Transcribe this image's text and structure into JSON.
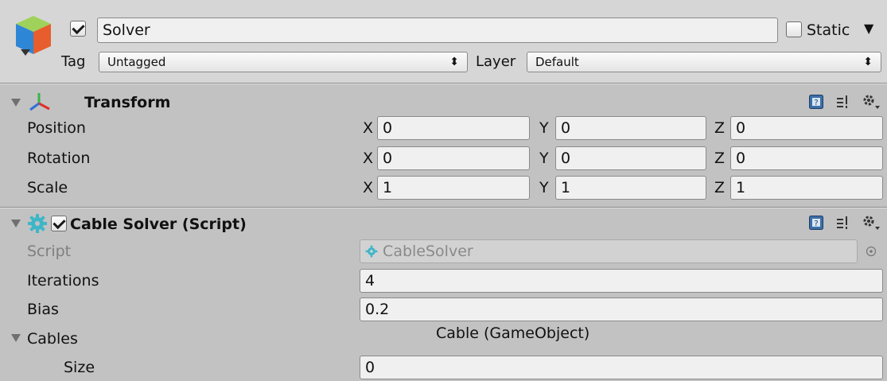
{
  "header": {
    "active_checked": true,
    "name": "Solver",
    "static_label": "Static",
    "static_checked": false,
    "tag_label": "Tag",
    "tag_value": "Untagged",
    "layer_label": "Layer",
    "layer_value": "Default",
    "popup_arrows": "⬍",
    "static_arrow": "▼"
  },
  "transform": {
    "title": "Transform",
    "rows": [
      {
        "label": "Position",
        "x": "0",
        "y": "0",
        "z": "0"
      },
      {
        "label": "Rotation",
        "x": "0",
        "y": "0",
        "z": "0"
      },
      {
        "label": "Scale",
        "x": "1",
        "y": "1",
        "z": "1"
      }
    ],
    "axes": {
      "x": "X",
      "y": "Y",
      "z": "Z"
    }
  },
  "cable_solver": {
    "title": "Cable Solver (Script)",
    "enabled": true,
    "script_label": "Script",
    "script_value": "CableSolver",
    "iterations_label": "Iterations",
    "iterations_value": "4",
    "bias_label": "Bias",
    "bias_value": "0.2",
    "cables_label": "Cables",
    "cables_type": "Cable (GameObject)",
    "size_label": "Size",
    "size_value": "0"
  },
  "colors": {
    "script_gear": "#3fb6c7",
    "help_icon": "#3c6fa8"
  },
  "icons": [
    "gameobject-cube-icon",
    "transform-axis-icon",
    "script-gear-icon",
    "help-icon",
    "preset-icon",
    "settings-gear-icon",
    "object-picker-icon",
    "fold-triangle-icon"
  ]
}
